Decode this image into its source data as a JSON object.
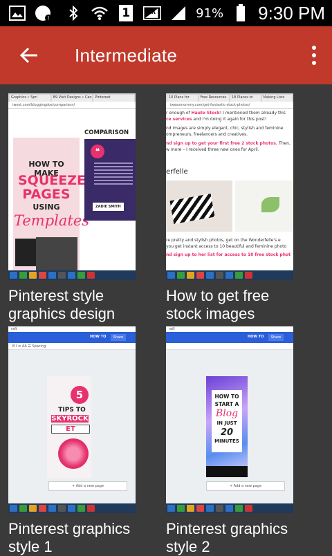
{
  "status_bar": {
    "sim_slot": "1",
    "battery_percent": "91%",
    "time": "9:30 PM",
    "icons": [
      "image-icon",
      "gallery-badge-icon",
      "bluetooth-icon",
      "wifi-icon",
      "sim-icon",
      "signal-r-icon",
      "signal-icon",
      "battery-icon"
    ]
  },
  "app_bar": {
    "title": "Intermediate",
    "back_icon": "back-arrow-icon",
    "overflow_icon": "more-vertical-icon",
    "color": "#c0392b"
  },
  "videos": [
    {
      "caption": "Pinterest style graphics design",
      "thumb": {
        "url": "iwest.com/bloggingdos/comparison/",
        "tabs": [
          "Graphics • Spri",
          "89 Visit Designs • Canva",
          "Pinterest"
        ],
        "heading": "COMPARISON",
        "pin_line1": "HOW TO MAKE",
        "pin_line2a": "SQUEEZE",
        "pin_line2b": "PAGES",
        "pin_line3": "USING",
        "pin_line4": "Templates",
        "badge": "ZADIE SMITH"
      }
    },
    {
      "caption": "How to get free stock images",
      "thumb": {
        "url": "iwesomommy.com/get-fantastic-stock-photos/",
        "tabs": [
          "10 Plans for",
          "Free Resources",
          "18 Places to",
          "Making Lists"
        ],
        "line1a": "r enough of ",
        "line1b": "Haute Stock",
        "line1c": "! I mentioned them already this",
        "line2a": "ce services",
        "line2b": " and I'm doing it again for this post!",
        "line3": "nd images are simply elegant, chic, stylish and feminine",
        "line4": "ompreneurs, freelancers and creatives.",
        "line5": "nd sign up to get your first free 2 stock photos.",
        "line5b": " Then,",
        "line6": "w more – I received three new ones for April.",
        "subhead": "erfelle",
        "foot1": "re pretty and stylish photos, get on the Wonderfelle's e",
        "foot2": "you get instant access to 10 beautiful and feminine photo",
        "foot3": "nd sign up to her list for access to 10 free stock phot"
      }
    },
    {
      "caption": "Pinterest graphics style 1",
      "thumb": {
        "top": "raft",
        "howto": "HOW TO",
        "share": "Share",
        "tools": "B  I  ≡  AA  ☰  Spacing",
        "number": "5",
        "tips": "TIPS TO",
        "skyrock": "SKYROCK",
        "et": "ET",
        "add_page": "+ Add a new page"
      }
    },
    {
      "caption": "Pinterest graphics style 2",
      "thumb": {
        "top": "raft",
        "howto": "HOW TO",
        "share": "Share",
        "line1": "HOW TO START A",
        "blog": "Blog",
        "line2": "IN JUST",
        "twenty": "20",
        "minutes": "MINUTES",
        "add_page": "+ Add a new page"
      }
    }
  ]
}
